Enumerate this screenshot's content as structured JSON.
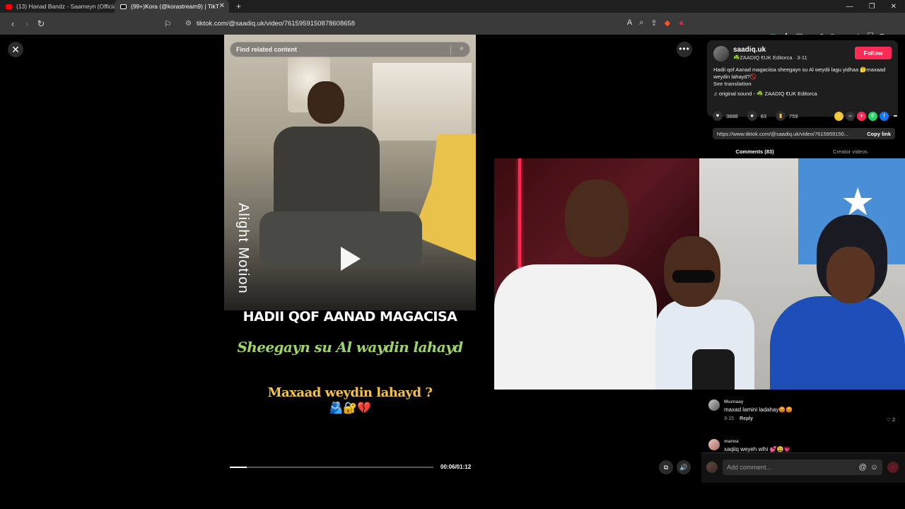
{
  "browser": {
    "tabs": [
      {
        "title": "(13) Hanad Bandz - Saameyn (Officia",
        "active": false
      },
      {
        "title": "(99+)Kora (@korastream9) | TikT",
        "active": true
      }
    ],
    "new_tab": "+",
    "url": "tiktok.com/@saadiq.uk/video/7615959150878608658",
    "window_controls": {
      "minimize": "—",
      "restore": "❐",
      "close": "✕"
    }
  },
  "player": {
    "search_placeholder": "Find related content",
    "watermark": "Alight Motion",
    "caption_line1": "HADII QOF AANAD MAGACISA",
    "caption_line2": "Sheegayn su Al waydin lahayd",
    "caption_line3": "Maxaad weydin lahayd ?",
    "caption_emojis": "🫂🔐💔",
    "time": "00:06/01:12",
    "progress_fraction": 0.083
  },
  "post": {
    "username": "saadiq.uk",
    "subline": "☘️ZAADIQ €UK Editorca · 3-11",
    "follow_label": "Follow",
    "description": "Hadii qof Aanad magaciisa sheegayn su Al weydii lagu yidhaa 🤔maxaad weydin lahayd?🚫",
    "see_translation": "See translation",
    "sound": "♫  original sound - ☘️ ZAADIQ €UK Editorca",
    "likes": "3888",
    "comments": "83",
    "saves": "759",
    "link": "https://www.tiktok.com/@saadiq.uk/video/7615959150...",
    "copy_link": "Copy link",
    "tab_comments": "Comments (83)",
    "tab_creator": "Creator videos"
  },
  "comments": [
    {
      "user": "Muznaay",
      "text": "maxad lamini ladahay😡😡",
      "date": "3-15",
      "reply": "Reply",
      "likes": "♡ 2"
    },
    {
      "user": "marwa",
      "text": "xaqiiq weyeh wlhi 💕😩💗",
      "date": "",
      "reply": "",
      "likes": ""
    }
  ],
  "comment_bar": {
    "placeholder": "Add comment...",
    "at": "@",
    "emoji": "☺",
    "send": "↑"
  },
  "colors": {
    "accent": "#fe2c55",
    "caption_green": "#9ed36a",
    "caption_yellow": "#f4c24a"
  }
}
